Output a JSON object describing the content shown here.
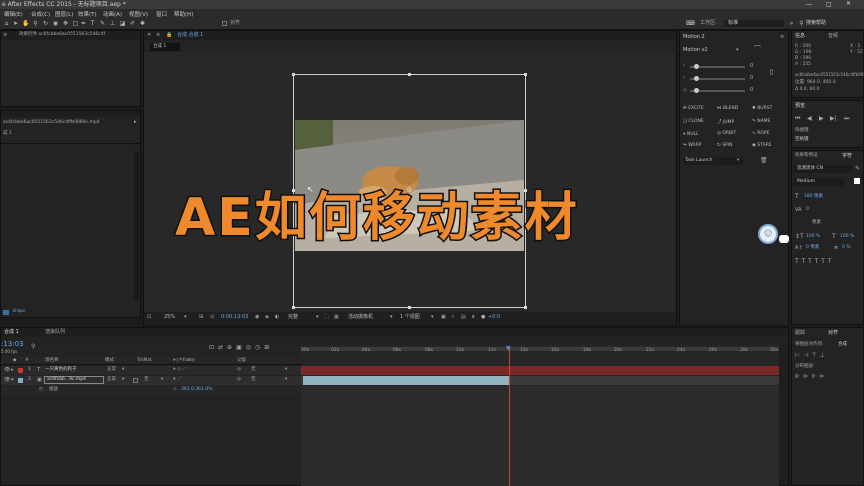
{
  "window": {
    "title": "e After Effects CC 2015 - 无标题项目.aep *"
  },
  "menu": [
    "编辑(E)",
    "合成(C)",
    "图层(L)",
    "效果(T)",
    "动画(A)",
    "视图(V)",
    "窗口",
    "帮助(H)"
  ],
  "toolbar": {
    "align_label": "对齐",
    "workspace_label": "工作区:",
    "workspace_value": "标准",
    "search_help": "搜索帮助"
  },
  "project": {
    "tab": "效果控件 ac6fcbbe6ac0551563c546c4f",
    "file_name": "ac6fcbbe6ac0551563c546c4ffb9089c.mp4",
    "comp_label": "成 1",
    "bpc": "8 bpc"
  },
  "composition": {
    "tab": "合成 合成 1",
    "sub_tab": "合成 1",
    "zoom": "25%",
    "timecode": "0:00:13:03",
    "resolution": "完整",
    "camera": "活动摄像机",
    "views": "1 个视图",
    "exposure": "+0.0"
  },
  "overlay_text": "AE如何移动素材",
  "motion": {
    "title": "Motion 2",
    "version": "Motion v2",
    "slider_values": [
      "0",
      "0",
      "0"
    ],
    "buttons": [
      "EXCITE",
      "BLEND",
      "BURST",
      "CLONE",
      "JUMP",
      "NAME",
      "NULL",
      "ORBIT",
      "ROPE",
      "WARP",
      "SPIN",
      "STARE"
    ],
    "task": "Task Launch"
  },
  "info": {
    "tab_info": "信息",
    "tab_audio": "音频",
    "r": "R : 200",
    "g": "G : 196",
    "b": "B : 190",
    "a": "A : 255",
    "x": "X : 1",
    "y": "Y : 52",
    "file_line": "ac6fcbbe6ac0551563c546c4ffb9089c",
    "position": "位置: 964.0, 460.0",
    "delta": "Δ 4.0, 60.0"
  },
  "preview": {
    "tab": "预览",
    "shortcut_label": "快捷键",
    "shortcut_value": "空格键"
  },
  "character": {
    "tab_effects": "效果和预设",
    "tab_char": "字符",
    "font": "思源黑体 CN",
    "style": "Medium",
    "size": "180 像素",
    "leading_label": "像素",
    "tracking": "0",
    "scale_v": "100 %",
    "scale_h": "100 %",
    "baseline": "0 像素",
    "tsume": "0 %"
  },
  "align_panel": {
    "tab_track": "跟踪",
    "tab_align": "对齐",
    "align_to": "将图层对齐到:",
    "align_to_value": "合成",
    "distribute": "分布图层:"
  },
  "timeline": {
    "tab": "合成 1",
    "tab_render": "渲染队列",
    "timecode": ":13:03",
    "fps": "5.00 fps",
    "col_source": "源名称",
    "col_mode": "模式",
    "col_trkmat": "TrkMat",
    "col_parent": "父级",
    "layers": [
      {
        "num": "1",
        "name": "一只黄色的狗子",
        "mode": "正常",
        "trkmat": "",
        "parent": "无",
        "color": "#c0392b"
      },
      {
        "num": "2",
        "name": "ac6fcbb...9c.mp4",
        "mode": "正常",
        "trkmat": "无",
        "parent": "无",
        "color": "#7fb2c9"
      }
    ],
    "scale_label": "缩放",
    "scale_value": "361.0,361.0%",
    "ruler": [
      "00s",
      "02s",
      "04s",
      "06s",
      "08s",
      "10s",
      "12s",
      "14s",
      "16s",
      "18s",
      "20s",
      "22s",
      "24s",
      "26s",
      "28s",
      "30s"
    ]
  }
}
